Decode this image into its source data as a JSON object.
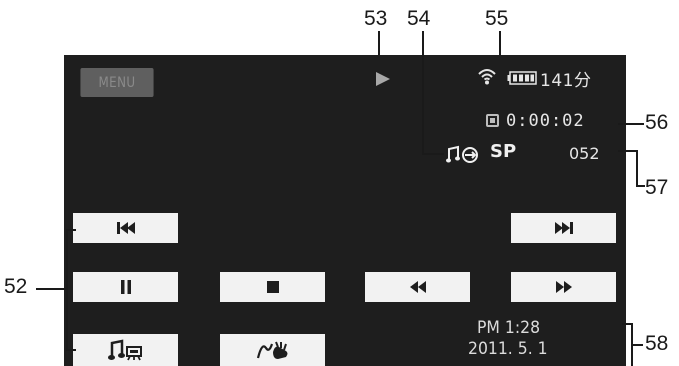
{
  "callouts": {
    "c52": "52",
    "c53": "53",
    "c54": "54",
    "c55": "55",
    "c56": "56",
    "c57": "57",
    "c58": "58"
  },
  "screen": {
    "menu_label": "MENU",
    "battery_remaining": "141分",
    "timecode": "0:00:02",
    "recording_mode": "SP",
    "scene_number": "052",
    "time": "PM   1:28",
    "date": "2011. 5. 1"
  },
  "icons": {
    "play": "play-icon",
    "wifi": "wifi-icon",
    "battery": "battery-icon",
    "memory_card": "memory-card-icon",
    "background_music": "music-mix-icon",
    "skip_back": "skip-back-icon",
    "skip_forward": "skip-forward-icon",
    "pause": "pause-icon",
    "stop": "stop-icon",
    "rewind": "rewind-icon",
    "fast_forward": "fast-forward-icon",
    "music_settings": "music-settings-icon",
    "decoration": "decoration-icon"
  },
  "colors": {
    "screen_bg": "#1e1e1e",
    "button_bg": "#f2f2f2",
    "button_icon": "#1e1e1e",
    "text": "#e6e6e6",
    "menu_bg": "#5f5f5f"
  }
}
